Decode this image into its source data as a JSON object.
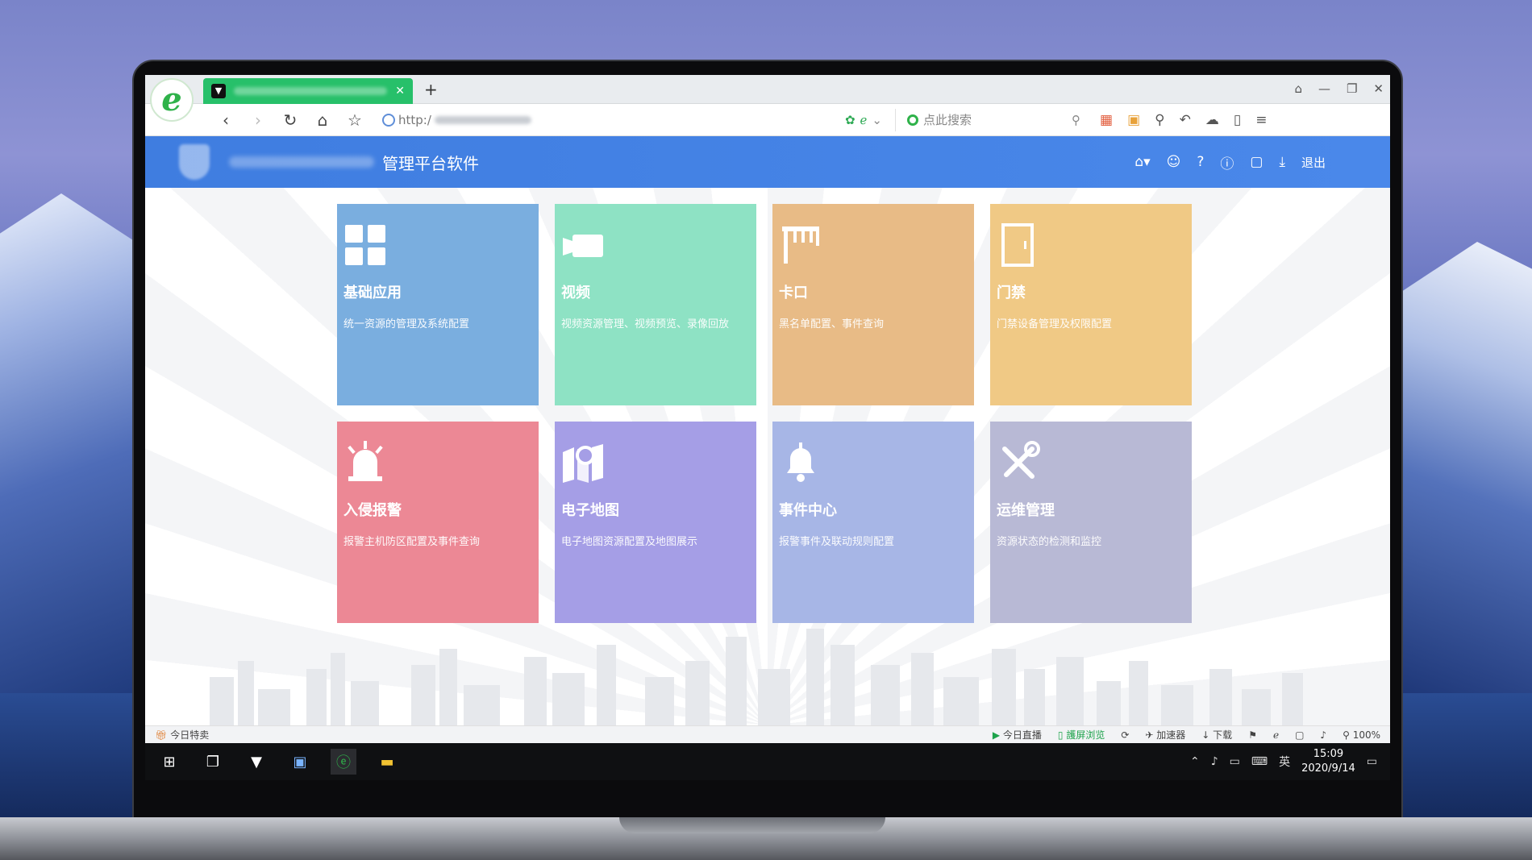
{
  "browser": {
    "url_prefix": "http:/",
    "search_placeholder": "点此搜索",
    "new_tab": "+",
    "tab_close": "✕"
  },
  "app": {
    "title": "管理平台软件",
    "logout": "退出"
  },
  "tiles": [
    {
      "name": "基础应用",
      "desc": "统一资源的管理及系统配置",
      "color": "#7aaedf",
      "icon": "grid-icon"
    },
    {
      "name": "视频",
      "desc": "视频资源管理、视频预览、录像回放",
      "color": "#8ee2c4",
      "icon": "camera-icon"
    },
    {
      "name": "卡口",
      "desc": "黑名单配置、事件查询",
      "color": "#e8bb86",
      "icon": "barrier-gate-icon"
    },
    {
      "name": "门禁",
      "desc": "门禁设备管理及权限配置",
      "color": "#f0c985",
      "icon": "door-icon"
    },
    {
      "name": "入侵报警",
      "desc": "报警主机防区配置及事件查询",
      "color": "#ec8895",
      "icon": "alarm-siren-icon"
    },
    {
      "name": "电子地图",
      "desc": "电子地图资源配置及地图展示",
      "color": "#a59ee6",
      "icon": "map-pin-icon"
    },
    {
      "name": "事件中心",
      "desc": "报警事件及联动规则配置",
      "color": "#a7b6e6",
      "icon": "bell-icon"
    },
    {
      "name": "运维管理",
      "desc": "资源状态的检测和监控",
      "color": "#b8b9d5",
      "icon": "tools-icon"
    }
  ],
  "statusbar": {
    "left": "今日特卖",
    "live": "今日直播",
    "screen": "護屏浏览",
    "accelerator": "加速器",
    "download": "下载",
    "zoom": "100%"
  },
  "taskbar": {
    "ime": "英",
    "time": "15:09",
    "date": "2020/9/14"
  }
}
